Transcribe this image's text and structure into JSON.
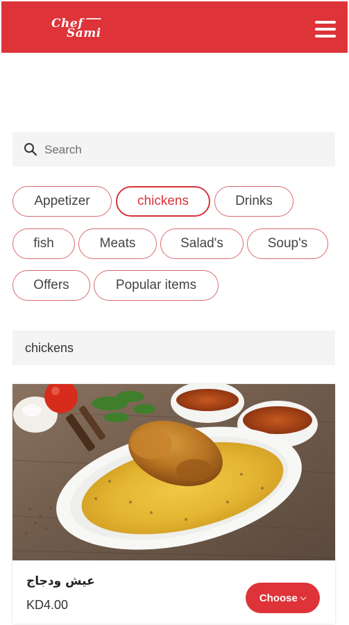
{
  "header": {
    "logo_line1": "Chef",
    "logo_line2": "Sami",
    "brand_color": "#dd3339",
    "menu_icon": "hamburger-menu-icon"
  },
  "search": {
    "placeholder": "Search",
    "value": "",
    "icon": "search-icon"
  },
  "categories": [
    {
      "label": "Appetizer",
      "active": false
    },
    {
      "label": "chickens",
      "active": true
    },
    {
      "label": "Drinks",
      "active": false
    },
    {
      "label": "fish",
      "active": false
    },
    {
      "label": "Meats",
      "active": false
    },
    {
      "label": "Salad's",
      "active": false
    },
    {
      "label": "Soup's",
      "active": false
    },
    {
      "label": "Offers",
      "active": false
    },
    {
      "label": "Popular items",
      "active": false
    }
  ],
  "section": {
    "title": "chickens"
  },
  "items": [
    {
      "name": "عيش ودجاج",
      "price": "KD4.00",
      "button_label": "Choose",
      "button_icon": "chevron-down-icon"
    }
  ]
}
